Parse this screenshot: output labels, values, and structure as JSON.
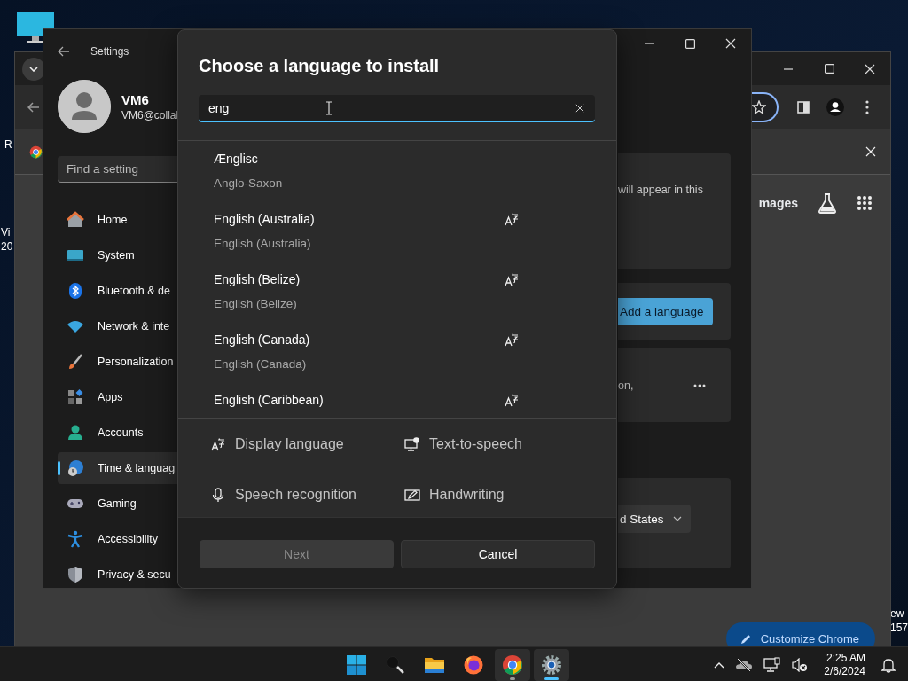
{
  "desktop": {
    "left_labels": [
      "R",
      "Vi",
      "20"
    ],
    "right_labels": [
      "ew",
      "157"
    ]
  },
  "chrome": {
    "page_link": "mages",
    "customize_button": "Customize Chrome"
  },
  "settings": {
    "title": "Settings",
    "user": {
      "name": "VM6",
      "email": "VM6@collal"
    },
    "search": {
      "placeholder": "Find a setting"
    },
    "nav": [
      {
        "kind": "home",
        "label": "Home",
        "selected": false
      },
      {
        "kind": "system",
        "label": "System",
        "selected": false
      },
      {
        "kind": "bluetooth",
        "label": "Bluetooth & de",
        "selected": false
      },
      {
        "kind": "network",
        "label": "Network & inte",
        "selected": false
      },
      {
        "kind": "personalization",
        "label": "Personalization",
        "selected": false
      },
      {
        "kind": "apps",
        "label": "Apps",
        "selected": false
      },
      {
        "kind": "accounts",
        "label": "Accounts",
        "selected": false
      },
      {
        "kind": "time",
        "label": "Time & languag",
        "selected": true
      },
      {
        "kind": "gaming",
        "label": "Gaming",
        "selected": false
      },
      {
        "kind": "accessibility",
        "label": "Accessibility",
        "selected": false
      },
      {
        "kind": "privacy",
        "label": "Privacy & secu",
        "selected": false
      }
    ],
    "content": {
      "card_text": "will appear in this",
      "add_button": "Add a language",
      "card_text_2": "on,",
      "region_dropdown": "d States"
    }
  },
  "dialog": {
    "title": "Choose a language to install",
    "search": {
      "value": "eng"
    },
    "languages": [
      {
        "name": "Ænglisc",
        "subtitle": "Anglo-Saxon",
        "display_language": false
      },
      {
        "name": "English (Australia)",
        "subtitle": "English (Australia)",
        "display_language": true
      },
      {
        "name": "English (Belize)",
        "subtitle": "English (Belize)",
        "display_language": true
      },
      {
        "name": "English (Canada)",
        "subtitle": "English (Canada)",
        "display_language": true
      },
      {
        "name": "English (Caribbean)",
        "display_language": true
      }
    ],
    "features": [
      {
        "kind": "display",
        "label": "Display language"
      },
      {
        "kind": "tts",
        "label": "Text-to-speech"
      },
      {
        "kind": "speech",
        "label": "Speech recognition"
      },
      {
        "kind": "handwriting",
        "label": "Handwriting"
      }
    ],
    "buttons": [
      {
        "label": "Next",
        "disabled": true
      },
      {
        "label": "Cancel",
        "disabled": false
      }
    ]
  },
  "taskbar": {
    "apps": [
      {
        "kind": "start",
        "open": false,
        "selected": false
      },
      {
        "kind": "search",
        "open": false,
        "selected": false
      },
      {
        "kind": "explorer",
        "open": false,
        "selected": false
      },
      {
        "kind": "firefox",
        "open": false,
        "selected": false
      },
      {
        "kind": "chrome",
        "open": true,
        "selected": false
      },
      {
        "kind": "settings",
        "open": true,
        "selected": true
      }
    ],
    "time": "2:25 AM",
    "date": "2/6/2024"
  }
}
